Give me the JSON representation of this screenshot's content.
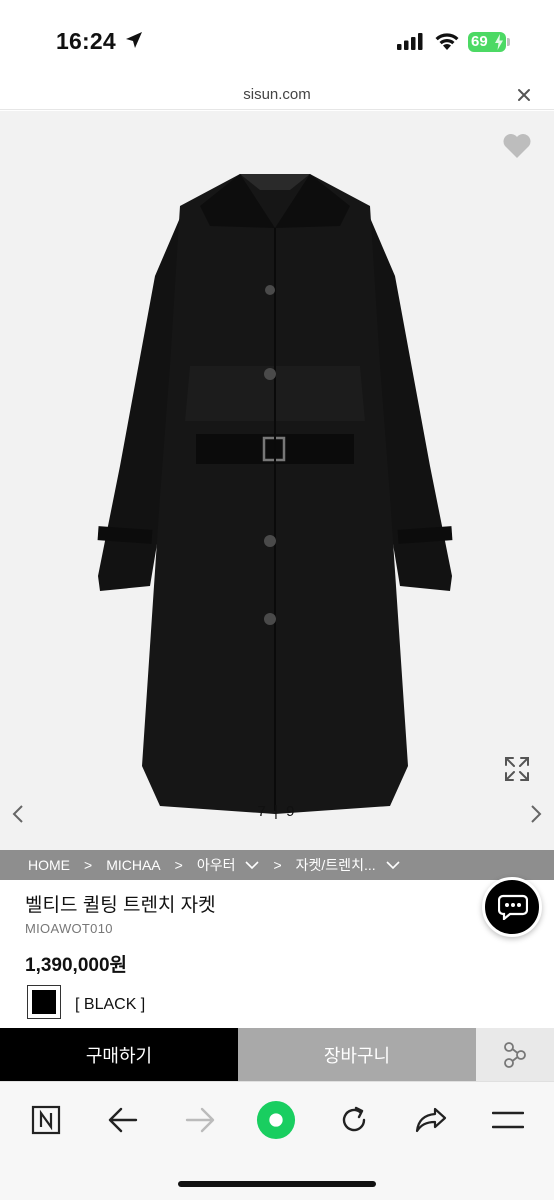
{
  "status_bar": {
    "time": "16:24",
    "battery": "69",
    "icons": [
      "location-arrow-icon",
      "signal-icon",
      "wifi-icon",
      "battery-icon"
    ]
  },
  "url_bar": {
    "domain": "sisun.com",
    "close_icon": "close-icon"
  },
  "gallery": {
    "counter": "7 | 9",
    "icons": [
      "heart-icon",
      "expand-icon",
      "chevron-left-icon",
      "chevron-right-icon"
    ]
  },
  "breadcrumb": {
    "items": [
      {
        "label": "HOME",
        "dropdown": false
      },
      {
        "label": "MICHAA",
        "dropdown": false
      },
      {
        "label": "아우터",
        "dropdown": true
      },
      {
        "label": "자켓/트렌치...",
        "dropdown": true
      }
    ],
    "separator": ">"
  },
  "product": {
    "title": "벨티드 퀼팅 트렌치 자켓",
    "code": "MIOAWOT010",
    "price": "1,390,000원",
    "color_label": "[ BLACK ]",
    "swatch_color": "#000000"
  },
  "actions": {
    "buy_label": "구매하기",
    "cart_label": "장바구니",
    "share_icon": "share-icon",
    "chat_icon": "chat-icon"
  },
  "browser_toolbar": {
    "icons": [
      "naver-n-icon",
      "back-arrow-icon",
      "forward-arrow-icon",
      "green-home-icon",
      "reload-icon",
      "share-arrow-icon",
      "menu-icon"
    ]
  },
  "colors": {
    "buy_bg": "#000000",
    "cart_bg": "#a9a9a9",
    "breadcrumb_bg": "#8e8e8e",
    "battery": "#4cd964",
    "toolbar_green": "#19ce60"
  }
}
